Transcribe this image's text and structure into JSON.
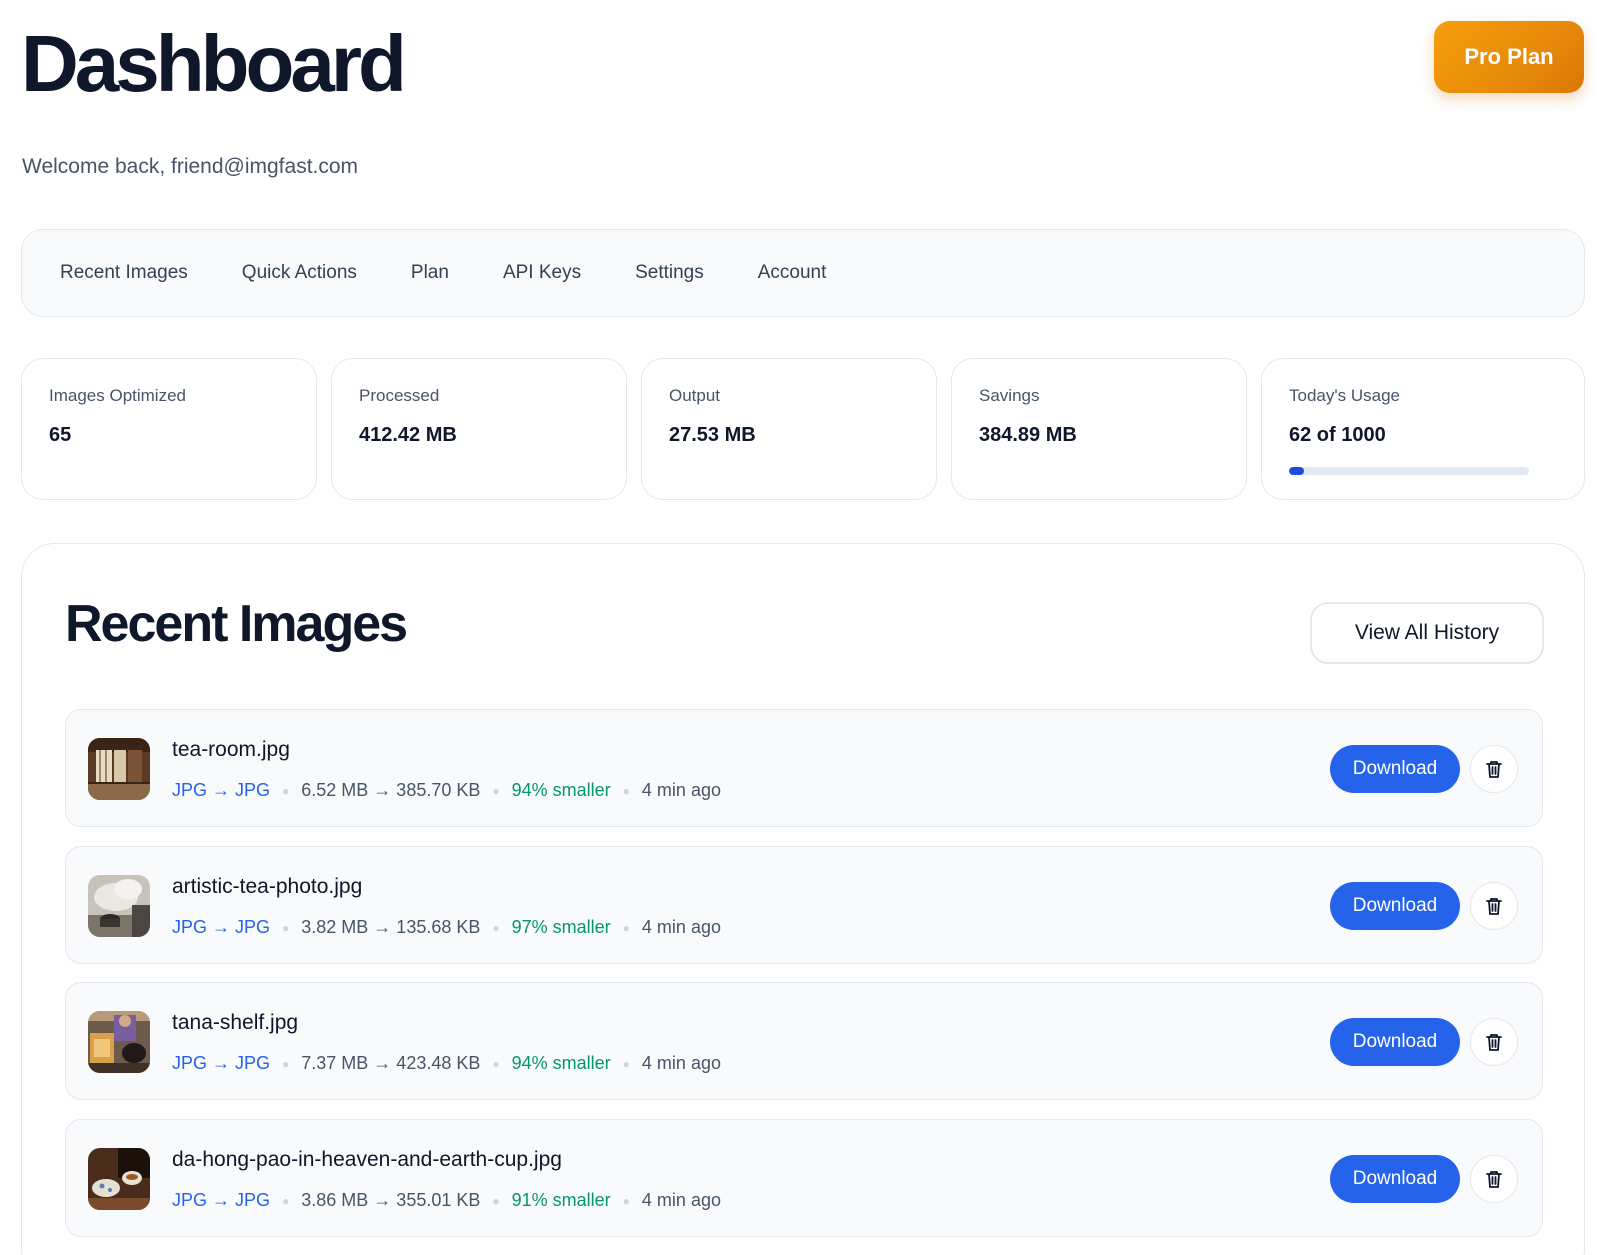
{
  "header": {
    "title": "Dashboard",
    "plan_button": "Pro Plan",
    "welcome": "Welcome back, friend@imgfast.com"
  },
  "nav": {
    "items": [
      "Recent Images",
      "Quick Actions",
      "Plan",
      "API Keys",
      "Settings",
      "Account"
    ]
  },
  "stats": [
    {
      "label": "Images Optimized",
      "value": "65"
    },
    {
      "label": "Processed",
      "value": "412.42 MB"
    },
    {
      "label": "Output",
      "value": "27.53 MB"
    },
    {
      "label": "Savings",
      "value": "384.89 MB"
    },
    {
      "label": "Today's Usage",
      "value": "62 of 1000",
      "progress": 0.062
    }
  ],
  "recent": {
    "title": "Recent Images",
    "history_button": "View All History",
    "download_label": "Download",
    "items": [
      {
        "name": "tea-room.jpg",
        "conversion": "JPG → JPG",
        "sizes": "6.52 MB → 385.70 KB",
        "saved": "94% smaller",
        "time": "4 min ago",
        "thumb_icon": "tea-room-thumbnail"
      },
      {
        "name": "artistic-tea-photo.jpg",
        "conversion": "JPG → JPG",
        "sizes": "3.82 MB → 135.68 KB",
        "saved": "97% smaller",
        "time": "4 min ago",
        "thumb_icon": "tea-steam-thumbnail"
      },
      {
        "name": "tana-shelf.jpg",
        "conversion": "JPG → JPG",
        "sizes": "7.37 MB → 423.48 KB",
        "saved": "94% smaller",
        "time": "4 min ago",
        "thumb_icon": "tea-shelf-thumbnail"
      },
      {
        "name": "da-hong-pao-in-heaven-and-earth-cup.jpg",
        "conversion": "JPG → JPG",
        "sizes": "3.86 MB → 355.01 KB",
        "saved": "91% smaller",
        "time": "4 min ago",
        "thumb_icon": "tea-cup-thumbnail"
      }
    ]
  },
  "colors": {
    "accent": "#2563eb",
    "plan_gradient_start": "#f59e0b",
    "plan_gradient_end": "#d97706",
    "savings_green": "#059669",
    "text_dark": "#0f172a",
    "border": "#e2e8f0"
  }
}
